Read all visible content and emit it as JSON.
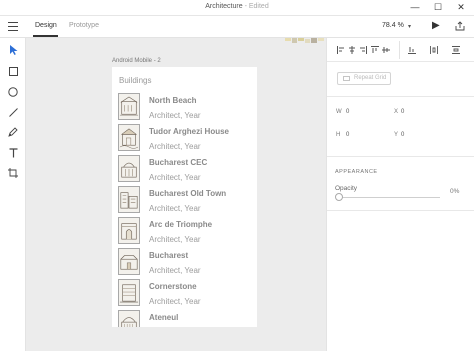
{
  "window": {
    "app_title": "Architecture",
    "separator": " - ",
    "edited_label": "Edited",
    "minimize_glyph": "—",
    "maximize_glyph": "☐",
    "close_glyph": "✕"
  },
  "toolbar": {
    "tabs": [
      {
        "label": "Design",
        "active": true
      },
      {
        "label": "Prototype",
        "active": false
      }
    ],
    "zoom": "78.4 %",
    "zoom_arrow": "▾",
    "play_glyph": "▶"
  },
  "tools": [
    "select-tool-icon",
    "rectangle-tool-icon",
    "ellipse-tool-icon",
    "line-tool-icon",
    "pen-tool-icon",
    "text-tool-icon",
    "artboard-tool-icon"
  ],
  "artboard": {
    "label": "Android Mobile - 2",
    "title": "Buildings",
    "items": [
      {
        "name": "North Beach",
        "subtitle": "Architect, Year"
      },
      {
        "name": "Tudor Arghezi House",
        "subtitle": "Architect, Year"
      },
      {
        "name": "Bucharest CEC",
        "subtitle": "Architect, Year"
      },
      {
        "name": "Bucharest Old Town",
        "subtitle": "Architect, Year"
      },
      {
        "name": "Arc de Triomphe",
        "subtitle": "Architect, Year"
      },
      {
        "name": "Bucharest",
        "subtitle": "Architect, Year"
      },
      {
        "name": "Cornerstone",
        "subtitle": "Architect, Year"
      },
      {
        "name": "Ateneul",
        "subtitle": ""
      }
    ]
  },
  "properties": {
    "repeat_grid_label": "Repeat Grid",
    "w_label": "W",
    "w_value": "0",
    "x_label": "X",
    "x_value": "0",
    "h_label": "H",
    "h_value": "0",
    "y_label": "Y",
    "y_value": "0",
    "appearance_label": "APPEARANCE",
    "opacity_label": "Opacity",
    "opacity_value": "0%"
  },
  "colors": {
    "canvas": "#ececec",
    "accent": "#333333",
    "select_tool": "#2d6fd6"
  }
}
